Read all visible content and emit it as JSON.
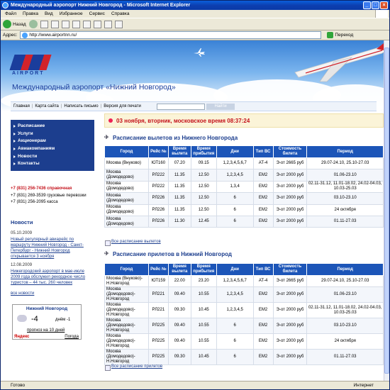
{
  "window": {
    "title": "Международный аэропорт Нижний Новгород - Microsoft Internet Explorer"
  },
  "menu": [
    "Файл",
    "Правка",
    "Вид",
    "Избранное",
    "Сервис",
    "Справка"
  ],
  "toolbar": {
    "back": "Назад",
    "go": "Переход"
  },
  "address": {
    "label": "Адрес:",
    "url": "http://www.airportnn.ru/"
  },
  "status": {
    "left": "Готово",
    "right": "Интернет"
  },
  "site": {
    "logo_text": "AIRPORT",
    "title": "Международный аэропорт «Нижний Новгород»",
    "nav": [
      "Главная",
      "Карта сайта",
      "Написать письмо",
      "Версия для печати"
    ],
    "search_button": "Найти"
  },
  "leftmenu": [
    "Расписание",
    "Услуги",
    "Акционерам",
    "Авиакомпаниям",
    "Новости",
    "Контакты"
  ],
  "phones": [
    {
      "text": "+7 (831) 256-7436 справочная",
      "highlight": true
    },
    {
      "text": "+7 (831) 269-3539 грузовые перевозки",
      "highlight": false
    },
    {
      "text": "+7 (831) 256-2095 касса",
      "highlight": false
    }
  ],
  "news": {
    "heading": "Новости",
    "items": [
      {
        "date": "05.10.2009",
        "text": "Новый регулярный авиарейс по маршруту Нижний Новгород - Санкт-Петербург - Нижний Новгород открывается 3 ноября"
      },
      {
        "date": "12.08.2009",
        "text": "Нижегородский аэропорт в мае-июле 2009 года обслужил рекордное число туристов – 44 тыс. 260 человек"
      }
    ],
    "all": "все новости"
  },
  "weather": {
    "title": "Нижний Новгород",
    "temp": "-4",
    "wind": "днём -1",
    "forecast": "прогноз на 10 дней",
    "brand": "Яндекс",
    "brand_link": "Погода"
  },
  "datebar": "03 ноября, вторник, московское время 08:37:24",
  "departures": {
    "heading": "Расписание вылетов из Нижнего Новгорода",
    "columns": [
      "Город",
      "Рейс №",
      "Время вылета",
      "Время прибытия",
      "Дни",
      "Тип ВС",
      "Стоимость билета",
      "Период"
    ],
    "rows": [
      [
        "Москва (Внуково)",
        "ЮТ160",
        "07.20",
        "09.15",
        "1,2,3,4,5,6,7",
        "АТ-4",
        "Э-от 2665 руб",
        "29.07-24.10, 25.10-27.03"
      ],
      [
        "Москва (Домодедово)",
        "РЛ222",
        "11.35",
        "12.50",
        "1,2,3,4,5",
        "EM2",
        "Э-от 2000 руб",
        "01.06-23.10"
      ],
      [
        "Москва (Домодедово)",
        "РЛ222",
        "11.35",
        "12.50",
        "1,3,4",
        "EM2",
        "Э-от 2000 руб",
        "02.11-31.12, 11.01-18.02, 24.02-04.03, 10.03-25.03"
      ],
      [
        "Москва (Домодедово)",
        "РЛ226",
        "11.35",
        "12.50",
        "6",
        "EM2",
        "Э-от 2000 руб",
        "03.10-23.10"
      ],
      [
        "Москва (Домодедово)",
        "РЛ226",
        "11.35",
        "12.50",
        "6",
        "EM2",
        "Э-от 2000 руб",
        "24 октября"
      ],
      [
        "Москва (Домодедово)",
        "РЛ226",
        "11.30",
        "12.45",
        "6",
        "EM2",
        "Э-от 2000 руб",
        "01.11-27.03"
      ]
    ],
    "all": "Все расписание вылетов"
  },
  "arrivals": {
    "heading": "Расписание прилетов в Нижний Новгород",
    "columns": [
      "Город",
      "Рейс №",
      "Время вылета",
      "Время прибытия",
      "Дни",
      "Тип ВС",
      "Стоимость билета",
      "Период"
    ],
    "rows": [
      [
        "Москва (Внуково)-Н.Новгород",
        "ЮТ159",
        "22.00",
        "23.20",
        "1,2,3,4,5,6,7",
        "АТ-4",
        "Э-от 2665 руб",
        "29.07-24.10, 25.10-27.03"
      ],
      [
        "Москва (Домодедово)-Н.Новгород",
        "РЛ221",
        "09.40",
        "10.55",
        "1,2,3,4,5",
        "EM2",
        "Э-от 2000 руб",
        "01.06-23.10"
      ],
      [
        "Москва (Домодедово)-Н.Новгород",
        "РЛ221",
        "09.30",
        "10.45",
        "1,2,3,4,5",
        "EM2",
        "Э-от 2000 руб",
        "02.11-31.12, 11.01-18.02, 24.02-04.03, 10.03-25.03"
      ],
      [
        "Москва (Домодедово)-Н.Новгород",
        "РЛ225",
        "09.40",
        "10.55",
        "6",
        "EM2",
        "Э-от 2000 руб",
        "03.10-23.10"
      ],
      [
        "Москва (Домодедово)-Н.Новгород",
        "РЛ225",
        "09.40",
        "10.55",
        "6",
        "EM2",
        "Э-от 2000 руб",
        "24 октября"
      ],
      [
        "Москва (Домодедово)-Н.Новгород",
        "РЛ225",
        "09.30",
        "10.45",
        "6",
        "EM2",
        "Э-от 2000 руб",
        "01.11-27.03"
      ]
    ],
    "all": "Все расписание прилетов"
  }
}
